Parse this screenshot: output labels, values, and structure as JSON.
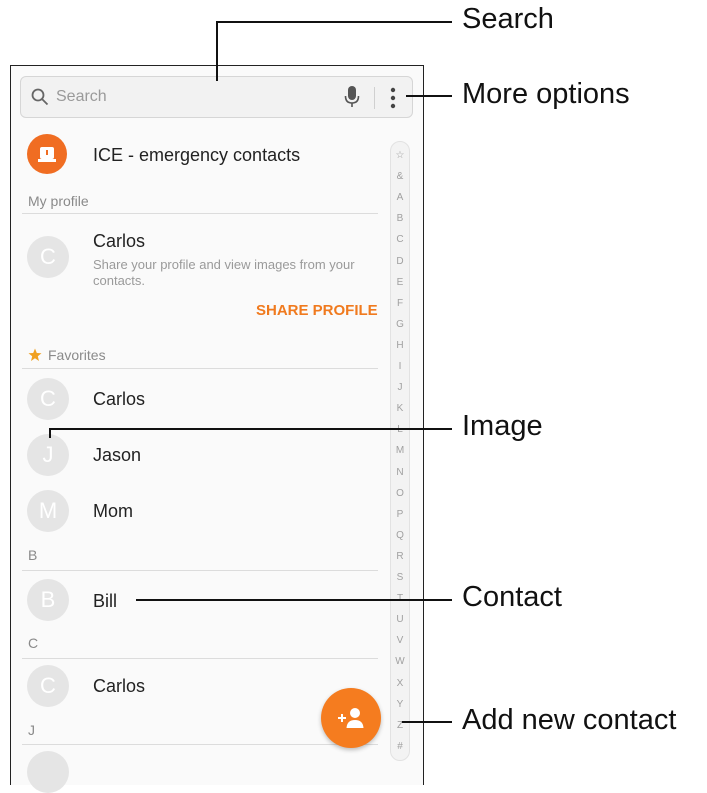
{
  "search": {
    "placeholder": "Search"
  },
  "ice": {
    "label": "ICE - emergency contacts"
  },
  "my_profile": {
    "header": "My profile",
    "name": "Carlos",
    "initial": "C",
    "description": "Share your profile and view images from your contacts.",
    "share_label": "SHARE PROFILE"
  },
  "favorites": {
    "header": "Favorites",
    "items": [
      {
        "initial": "C",
        "name": "Carlos"
      },
      {
        "initial": "J",
        "name": "Jason"
      },
      {
        "initial": "M",
        "name": "Mom"
      }
    ]
  },
  "groups": [
    {
      "letter": "B",
      "items": [
        {
          "initial": "B",
          "name": "Bill"
        }
      ]
    },
    {
      "letter": "C",
      "items": [
        {
          "initial": "C",
          "name": "Carlos"
        }
      ]
    },
    {
      "letter": "J",
      "items": []
    }
  ],
  "index_letters": [
    "☆",
    "&",
    "A",
    "B",
    "C",
    "D",
    "E",
    "F",
    "G",
    "H",
    "I",
    "J",
    "K",
    "L",
    "M",
    "N",
    "O",
    "P",
    "Q",
    "R",
    "S",
    "T",
    "U",
    "V",
    "W",
    "X",
    "Y",
    "Z",
    "#"
  ],
  "callouts": {
    "search": "Search",
    "more_options": "More options",
    "image": "Image",
    "contact": "Contact",
    "add_new_contact": "Add new contact"
  },
  "colors": {
    "accent": "#f57c1f",
    "avatar_bg": "#e5e5e5",
    "text": "#222222"
  },
  "icons": [
    "search-icon",
    "mic-icon",
    "more-options-icon",
    "ice-icon",
    "star-icon",
    "add-contact-icon"
  ]
}
